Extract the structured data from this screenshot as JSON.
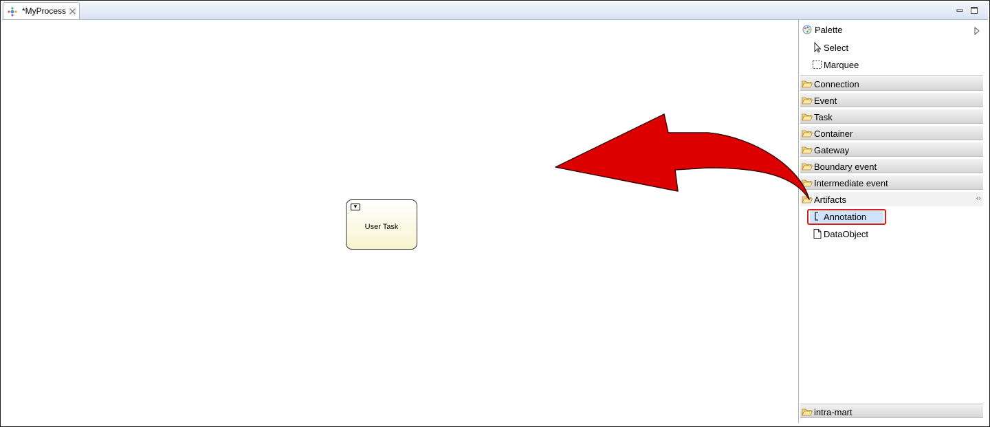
{
  "editor": {
    "tab_title": "*MyProcess",
    "tab_icon": "process-icon",
    "close_icon": "close-icon",
    "minimize_icon": "minimize-icon",
    "maximize_icon": "maximize-icon"
  },
  "canvas": {
    "task": {
      "label": "User Task",
      "icon": "user-task-icon"
    }
  },
  "palette": {
    "title": "Palette",
    "tools": [
      {
        "label": "Select",
        "icon": "select-arrow-icon"
      },
      {
        "label": "Marquee",
        "icon": "marquee-icon"
      }
    ],
    "drawers": [
      {
        "label": "Connection"
      },
      {
        "label": "Event"
      },
      {
        "label": "Task"
      },
      {
        "label": "Container"
      },
      {
        "label": "Gateway"
      },
      {
        "label": "Boundary event"
      },
      {
        "label": "Intermediate event"
      },
      {
        "label": "Artifacts",
        "expanded": true
      }
    ],
    "artifacts": [
      {
        "label": "Annotation",
        "icon": "annotation-icon",
        "selected": true
      },
      {
        "label": "DataObject",
        "icon": "data-object-icon"
      }
    ],
    "footer_drawer": {
      "label": "intra-mart"
    }
  },
  "overlay": {
    "arrow_color": "#dc0000"
  },
  "colors": {
    "highlight_border": "#d91c1c",
    "selection_bg": "#cfe3fb"
  }
}
